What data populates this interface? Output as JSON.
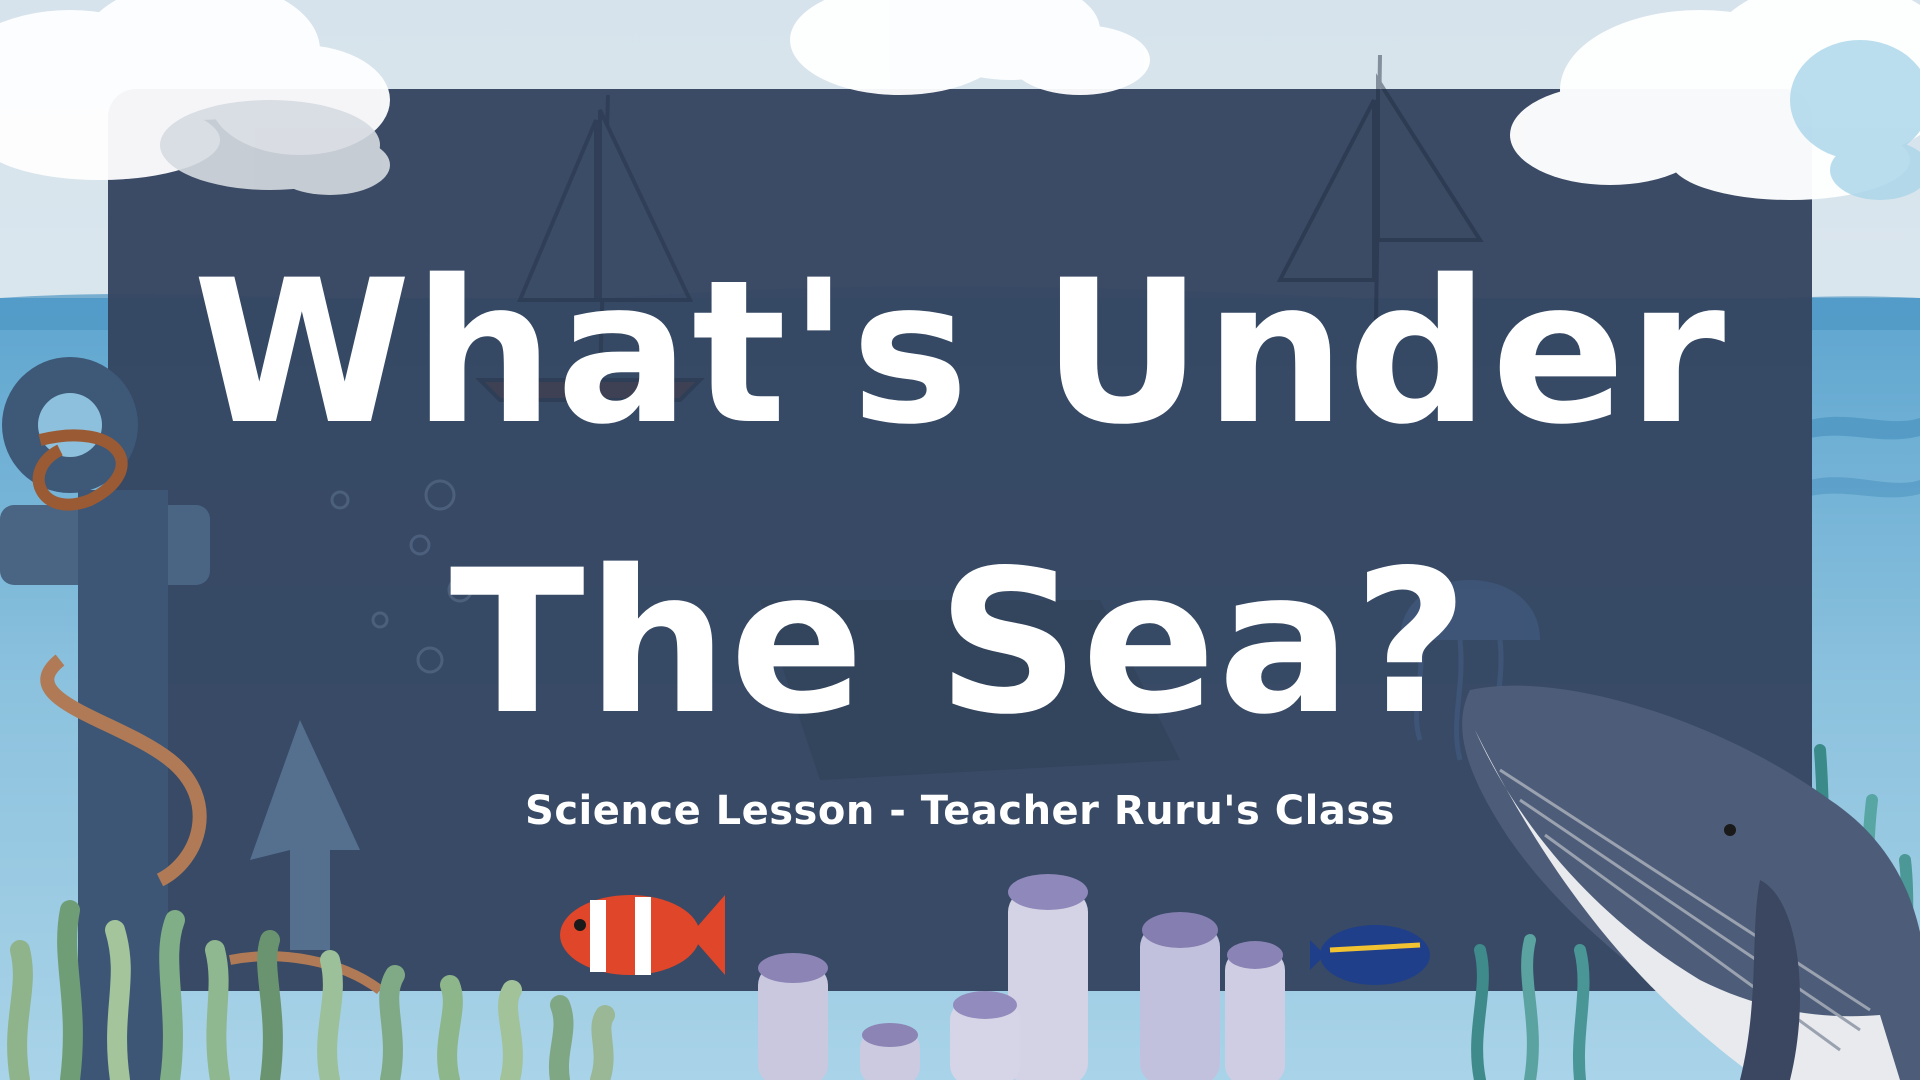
{
  "slide": {
    "title_line1": "What's Under",
    "title_line2": "The Sea?",
    "subtitle": "Science Lesson - Teacher Ruru's Class"
  },
  "colors": {
    "panel": "#344560",
    "sky": "#d9e6ee",
    "sea": "#7fb6d6",
    "text": "#ffffff"
  },
  "decorations": [
    "cloud-left",
    "cloud-right",
    "cloud-top",
    "sailboat-left",
    "sailboat-right",
    "anchor-icon",
    "seaweed",
    "clownfish-icon",
    "blue-tang-icon",
    "coral",
    "whale-icon",
    "jellyfish-icon",
    "bubbles"
  ]
}
